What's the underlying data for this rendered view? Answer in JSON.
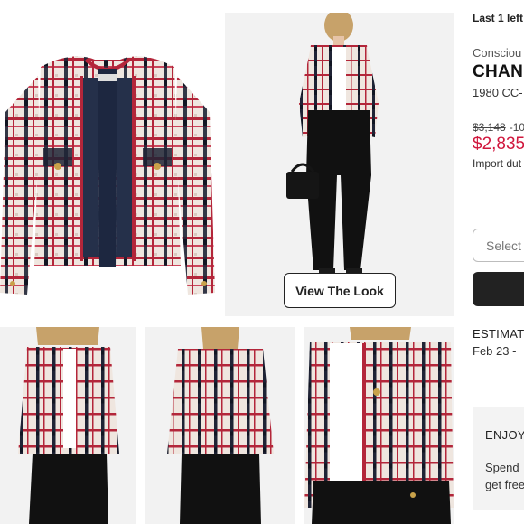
{
  "gallery": {
    "hero_alt": "Chanel tweed jacket",
    "view_look_label": "View The Look"
  },
  "product": {
    "stock_note": "Last 1 left",
    "brand_sub": "Consciou",
    "brand": "CHANE",
    "description": "1980 CC-",
    "price_original": "$3,148",
    "discount": "-10",
    "price_sale": "$2,835",
    "import_note": "Import dut"
  },
  "size_select": {
    "placeholder": "Select"
  },
  "delivery": {
    "label": "ESTIMATI",
    "date": "Feb 23 -"
  },
  "promo": {
    "title": "ENJOY",
    "line1": "Spend",
    "line2": "get free"
  },
  "colors": {
    "sale_red": "#d0173d",
    "tweed_red": "#b3263a",
    "tweed_navy": "#1f2335",
    "tweed_cream": "#efe6df",
    "button_dark": "#222222"
  }
}
